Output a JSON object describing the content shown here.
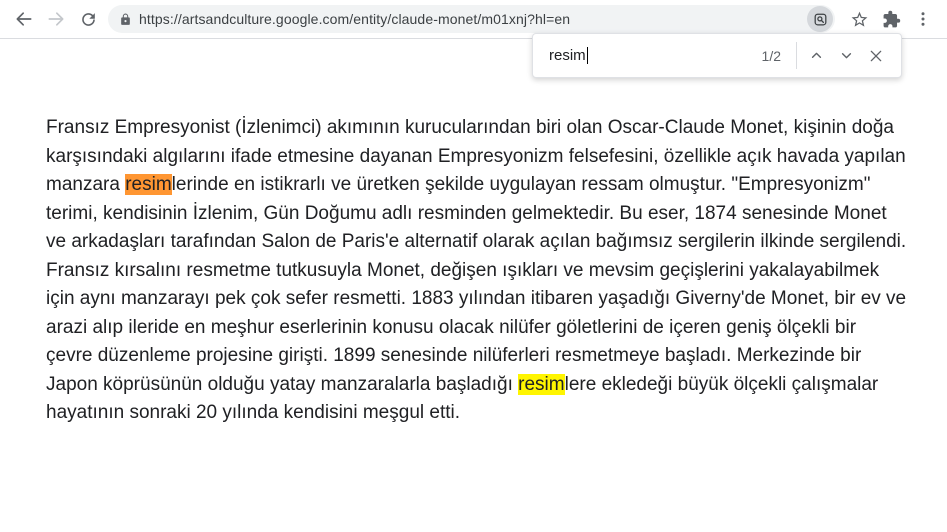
{
  "browser": {
    "url": "https://artsandculture.google.com/entity/claude-monet/m01xnj?hl=en",
    "icons": [
      "back-icon",
      "forward-icon",
      "reload-icon",
      "lock-icon",
      "lens-icon",
      "star-icon",
      "extensions-icon",
      "menu-icon"
    ]
  },
  "find_bar": {
    "query": "resim",
    "match_count": "1/2",
    "icons": [
      "find-previous-icon",
      "find-next-icon",
      "close-icon"
    ]
  },
  "article": {
    "paragraphs": [
      {
        "segments": [
          {
            "text": "Fransız Empresyonist (İzlenimci) akımının kurucularından biri olan Oscar-Claude Monet, kişinin doğa karşısındaki algılarını ifade etmesine dayanan Empresyonizm felsefesini, özellikle açık havada yapılan manzara ",
            "hl": "none"
          },
          {
            "text": "resim",
            "hl": "active"
          },
          {
            "text": "lerinde en istikrarlı ve üretken şekilde uygulayan ressam olmuştur. \"Empresyonizm\" terimi, kendisinin İzlenim, Gün Doğumu adlı resminden gelmektedir. Bu eser, 1874 senesinde Monet ve arkadaşları tarafından Salon de Paris'e alternatif olarak açılan bağımsız sergilerin ilkinde sergilendi.",
            "hl": "none"
          }
        ]
      },
      {
        "segments": [
          {
            "text": "Fransız kırsalını resmetme tutkusuyla Monet, değişen ışıkları ve mevsim geçişlerini yakalayabilmek için aynı manzarayı pek çok sefer resmetti. 1883 yılından itibaren yaşadığı Giverny'de Monet, bir ev ve arazi alıp ileride en meşhur eserlerinin konusu olacak nilüfer göletlerini de içeren geniş ölçekli bir çevre düzenleme projesine girişti. 1899 senesinde nilüferleri resmetmeye başladı. Merkezinde bir Japon köprüsünün olduğu yatay manzaralarla başladığı ",
            "hl": "none"
          },
          {
            "text": "resim",
            "hl": "inactive"
          },
          {
            "text": "lere ekledeği büyük ölçekli çalışmalar hayatının sonraki 20 yılında kendisini meşgul etti.",
            "hl": "none"
          }
        ]
      }
    ]
  },
  "colors": {
    "toolbar_bg": "#ffffff",
    "toolbar_border": "#dadce0",
    "omnibox_bg": "#f1f3f4",
    "icon_gray": "#5f6368",
    "disabled_icon": "#c4c7cb",
    "url_text": "#3c4043",
    "body_text": "#202124",
    "active_highlight": "#ff9632",
    "inactive_highlight": "#fff500"
  }
}
